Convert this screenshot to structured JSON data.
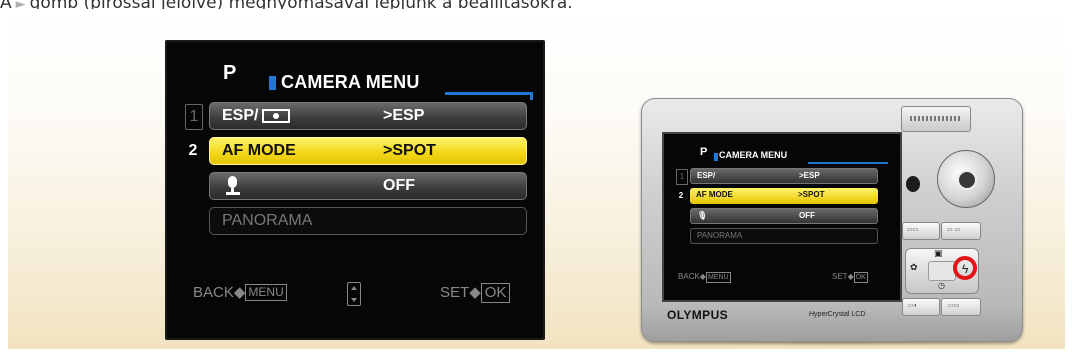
{
  "caption": {
    "prefix": "A",
    "text": "gomb (pirossal jelölve) megnyomásával lépjünk a beállításokra."
  },
  "menu": {
    "mode": "P",
    "title": "CAMERA MENU",
    "rows": [
      {
        "num": "1",
        "label": "ESP/",
        "value": ">ESP",
        "state": "normal"
      },
      {
        "num": "2",
        "label": "AF MODE",
        "value": ">SPOT",
        "state": "selected"
      },
      {
        "num": "",
        "label": "",
        "value": "OFF",
        "state": "normal"
      },
      {
        "num": "",
        "label": "PANORAMA",
        "value": "",
        "state": "disabled"
      }
    ],
    "footer": {
      "back": "BACK",
      "back_btn": "MENU",
      "set": "SET",
      "set_btn": "OK"
    }
  },
  "camera": {
    "brand": "OLYMPUS",
    "lcd_label": "HyperCrystal LCD",
    "screen_title": "CAMERA MENU",
    "highlighted_button": "flash-right-button",
    "highlight_color": "#e2151b"
  },
  "colors": {
    "selected_row": "#f2d81a",
    "accent_blue": "#1f78d1"
  }
}
